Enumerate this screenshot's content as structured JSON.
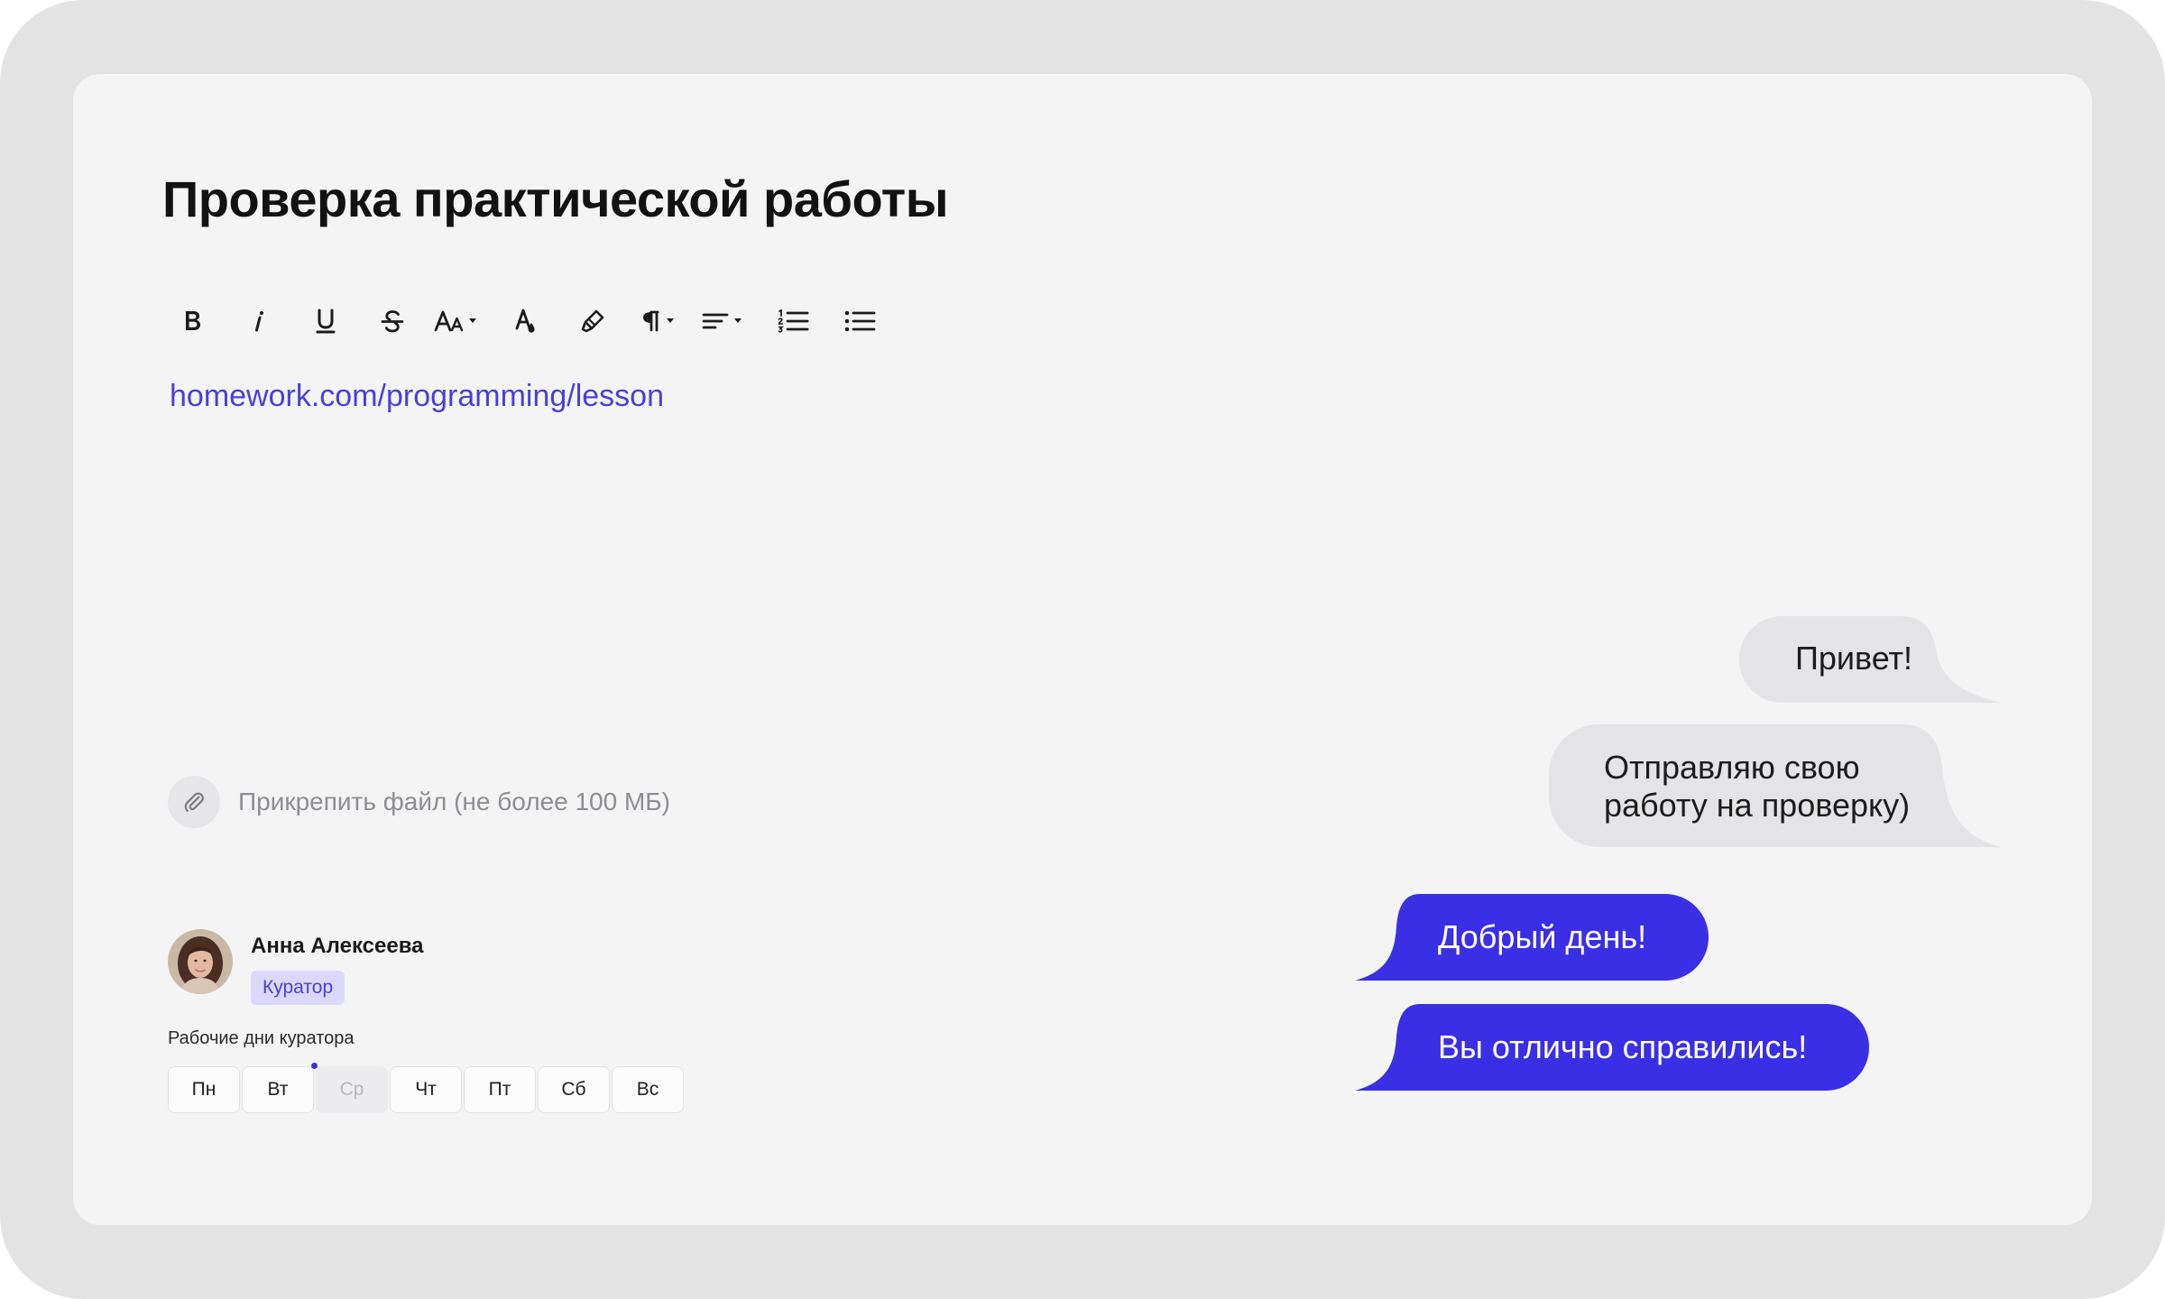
{
  "page": {
    "title": "Проверка практической работы"
  },
  "editor": {
    "toolbar": [
      {
        "name": "bold-button",
        "icon": "bold-icon"
      },
      {
        "name": "italic-button",
        "icon": "italic-icon"
      },
      {
        "name": "underline-button",
        "icon": "underline-icon"
      },
      {
        "name": "strikethrough-button",
        "icon": "strikethrough-icon"
      },
      {
        "name": "font-size-button",
        "icon": "font-size-icon"
      },
      {
        "name": "text-color-button",
        "icon": "text-color-icon"
      },
      {
        "name": "highlight-button",
        "icon": "highlighter-icon"
      },
      {
        "name": "paragraph-button",
        "icon": "pilcrow-icon"
      },
      {
        "name": "align-button",
        "icon": "align-left-icon"
      },
      {
        "name": "numbered-list-button",
        "icon": "numbered-list-icon"
      },
      {
        "name": "bullet-list-button",
        "icon": "bullet-list-icon"
      }
    ],
    "link_text": "homework.com/programming/lesson"
  },
  "attach": {
    "label": "Прикрепить файл (не более 100 МБ)",
    "icon": "paperclip-icon"
  },
  "curator": {
    "name": "Анна Алексеева",
    "role": "Куратор",
    "days_label": "Рабочие дни куратора",
    "days": [
      {
        "label": "Пн",
        "active": true
      },
      {
        "label": "Вт",
        "active": true
      },
      {
        "label": "Ср",
        "active": false
      },
      {
        "label": "Чт",
        "active": true
      },
      {
        "label": "Пт",
        "active": true
      },
      {
        "label": "Сб",
        "active": true
      },
      {
        "label": "Вс",
        "active": true
      }
    ]
  },
  "chat": {
    "messages": [
      {
        "side": "incoming",
        "lines": [
          "Привет!"
        ]
      },
      {
        "side": "incoming",
        "lines": [
          "Отправляю свою",
          "работу на проверку)"
        ]
      },
      {
        "side": "outgoing",
        "lines": [
          "Добрый день!"
        ]
      },
      {
        "side": "outgoing",
        "lines": [
          "Вы отлично справились!"
        ]
      }
    ]
  },
  "colors": {
    "accent": "#3b2fe6",
    "link": "#4b3fd8",
    "incoming_bubble": "#e4e4e6",
    "badge_bg": "#dcd8fb",
    "card_bg": "#f4f4f5",
    "frame_bg": "#e3e3e3"
  }
}
